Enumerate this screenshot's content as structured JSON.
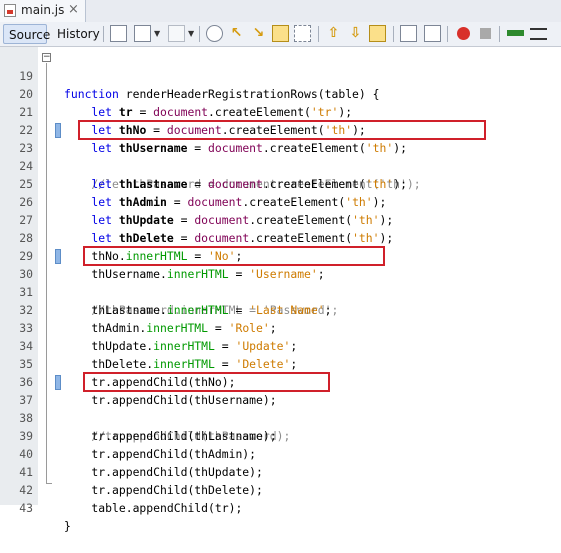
{
  "tab": {
    "filename": "main.js",
    "close": "×"
  },
  "toolbar": {
    "source_label": "Source",
    "history_label": "History"
  },
  "colors": {
    "highlight_box": "#d0202a",
    "keyword": "#0000e6",
    "comment": "#8c8c8c",
    "string": "#ce7b00",
    "property": "#009900"
  },
  "code": {
    "lines": [
      {
        "n": "19"
      },
      {
        "n": "20"
      },
      {
        "n": "21"
      },
      {
        "n": "22"
      },
      {
        "n": "23"
      },
      {
        "n": "24"
      },
      {
        "n": "25"
      },
      {
        "n": "26"
      },
      {
        "n": "27"
      },
      {
        "n": "28"
      },
      {
        "n": "29"
      },
      {
        "n": "30"
      },
      {
        "n": "31"
      },
      {
        "n": "32"
      },
      {
        "n": "33"
      },
      {
        "n": "34"
      },
      {
        "n": "35"
      },
      {
        "n": "36"
      },
      {
        "n": "37"
      },
      {
        "n": "38"
      },
      {
        "n": "39"
      },
      {
        "n": "40"
      },
      {
        "n": "41"
      },
      {
        "n": "42"
      },
      {
        "n": "43"
      }
    ],
    "l19": {
      "a": "function ",
      "b": "renderHeaderRegistrationRows",
      "c": "(table) {"
    },
    "l20": {
      "a": "    let ",
      "b": "tr",
      "c": " = ",
      "d": "document",
      "e": ".createElement(",
      "f": "'tr'",
      "g": ");"
    },
    "l21": {
      "a": "    let ",
      "b": "thNo",
      "c": " = ",
      "d": "document",
      "e": ".createElement(",
      "f": "'th'",
      "g": ");"
    },
    "l22": {
      "a": "    let ",
      "b": "thUsername",
      "c": " = ",
      "d": "document",
      "e": ".createElement(",
      "f": "'th'",
      "g": ");"
    },
    "l23": {
      "a": "    //let thPassword = document.createElement('th');"
    },
    "l24": {
      "a": "    let ",
      "b": "thLastname",
      "c": " = ",
      "d": "document",
      "e": ".createElement(",
      "f": "'th'",
      "g": ");"
    },
    "l25": {
      "a": "    let ",
      "b": "thAdmin",
      "c": " = ",
      "d": "document",
      "e": ".createElement(",
      "f": "'th'",
      "g": ");"
    },
    "l26": {
      "a": "    let ",
      "b": "thUpdate",
      "c": " = ",
      "d": "document",
      "e": ".createElement(",
      "f": "'th'",
      "g": ");"
    },
    "l27": {
      "a": "    let ",
      "b": "thDelete",
      "c": " = ",
      "d": "document",
      "e": ".createElement(",
      "f": "'th'",
      "g": ");"
    },
    "l28": {
      "a": "    thNo.",
      "b": "innerHTML",
      "c": " = ",
      "d": "'No'",
      "e": ";"
    },
    "l29": {
      "a": "    thUsername.",
      "b": "innerHTML",
      "c": " = ",
      "d": "'Username'",
      "e": ";"
    },
    "l30": {
      "a": "    //thPassword.innerHTML = 'Password';"
    },
    "l31": {
      "a": "    thLastname.",
      "b": "innerHTML",
      "c": " = ",
      "d": "'Last Name'",
      "e": ";"
    },
    "l32": {
      "a": "    thAdmin.",
      "b": "innerHTML",
      "c": " = ",
      "d": "'Role'",
      "e": ";"
    },
    "l33": {
      "a": "    thUpdate.",
      "b": "innerHTML",
      "c": " = ",
      "d": "'Update'",
      "e": ";"
    },
    "l34": {
      "a": "    thDelete.",
      "b": "innerHTML",
      "c": " = ",
      "d": "'Delete'",
      "e": ";"
    },
    "l35": {
      "a": "    tr.appendChild(thNo);"
    },
    "l36": {
      "a": "    tr.appendChild(thUsername);"
    },
    "l37": {
      "a": "    //tr.appendChild(thPassword);"
    },
    "l38": {
      "a": "    tr.appendChild(thLastname);"
    },
    "l39": {
      "a": "    tr.appendChild(thAdmin);"
    },
    "l40": {
      "a": "    tr.appendChild(thUpdate);"
    },
    "l41": {
      "a": "    tr.appendChild(thDelete);"
    },
    "l42": {
      "a": "    table.appendChild(tr);"
    },
    "l43": {
      "a": "}"
    }
  }
}
